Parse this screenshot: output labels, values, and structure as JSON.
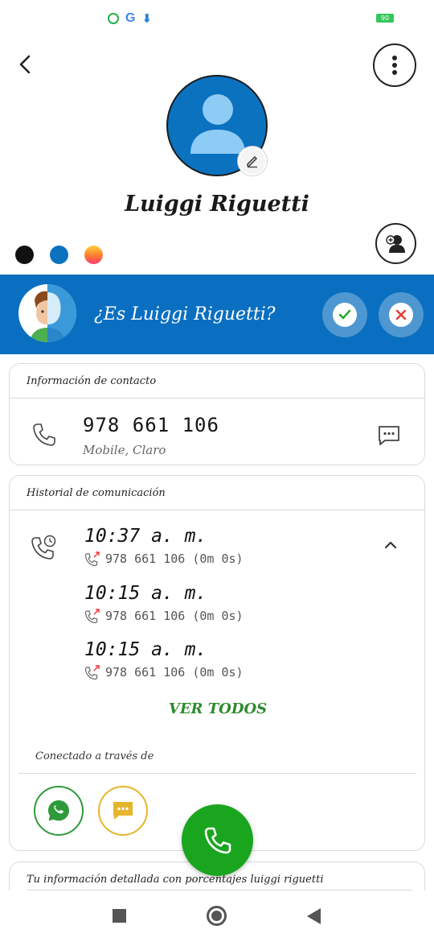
{
  "status_bar": {
    "icons": [
      "whatsapp-icon",
      "google-icon",
      "download-icon"
    ],
    "google_glyph": "G",
    "battery_text": "90"
  },
  "header": {
    "back_icon": "back-arrow-icon",
    "menu_icon": "more-vertical-icon"
  },
  "contact": {
    "name": "Luiggi Riguetti",
    "avatar_color": "#0b72bf",
    "theme_colors": [
      "#111111",
      "#0b72bf",
      "gradient-orange-pink"
    ]
  },
  "banner": {
    "question": "¿Es Luiggi Riguetti?",
    "background": "#0a6fc0",
    "confirm_icon": "check-icon",
    "reject_icon": "close-icon"
  },
  "contact_info": {
    "title": "Información de contacto",
    "phone": "978 661 106",
    "carrier": "Mobile, Claro"
  },
  "history": {
    "title": "Historial de comunicación",
    "calls": [
      {
        "time": "10:37 a. m.",
        "detail": "978 661 106 (0m 0s)"
      },
      {
        "time": "10:15 a. m.",
        "detail": "978 661 106 (0m 0s)"
      },
      {
        "time": "10:15 a. m.",
        "detail": "978 661 106 (0m 0s)"
      }
    ],
    "view_all": "VER TODOS",
    "connected_label": "Conectado a través de"
  },
  "detail": {
    "title": "Tu información detallada con porcentajes luiggi riguetti"
  },
  "colors": {
    "accent_green": "#1aa51f",
    "link_green": "#2e8b2e",
    "message_yellow": "#e5b52d",
    "missed_red": "#e53935"
  }
}
